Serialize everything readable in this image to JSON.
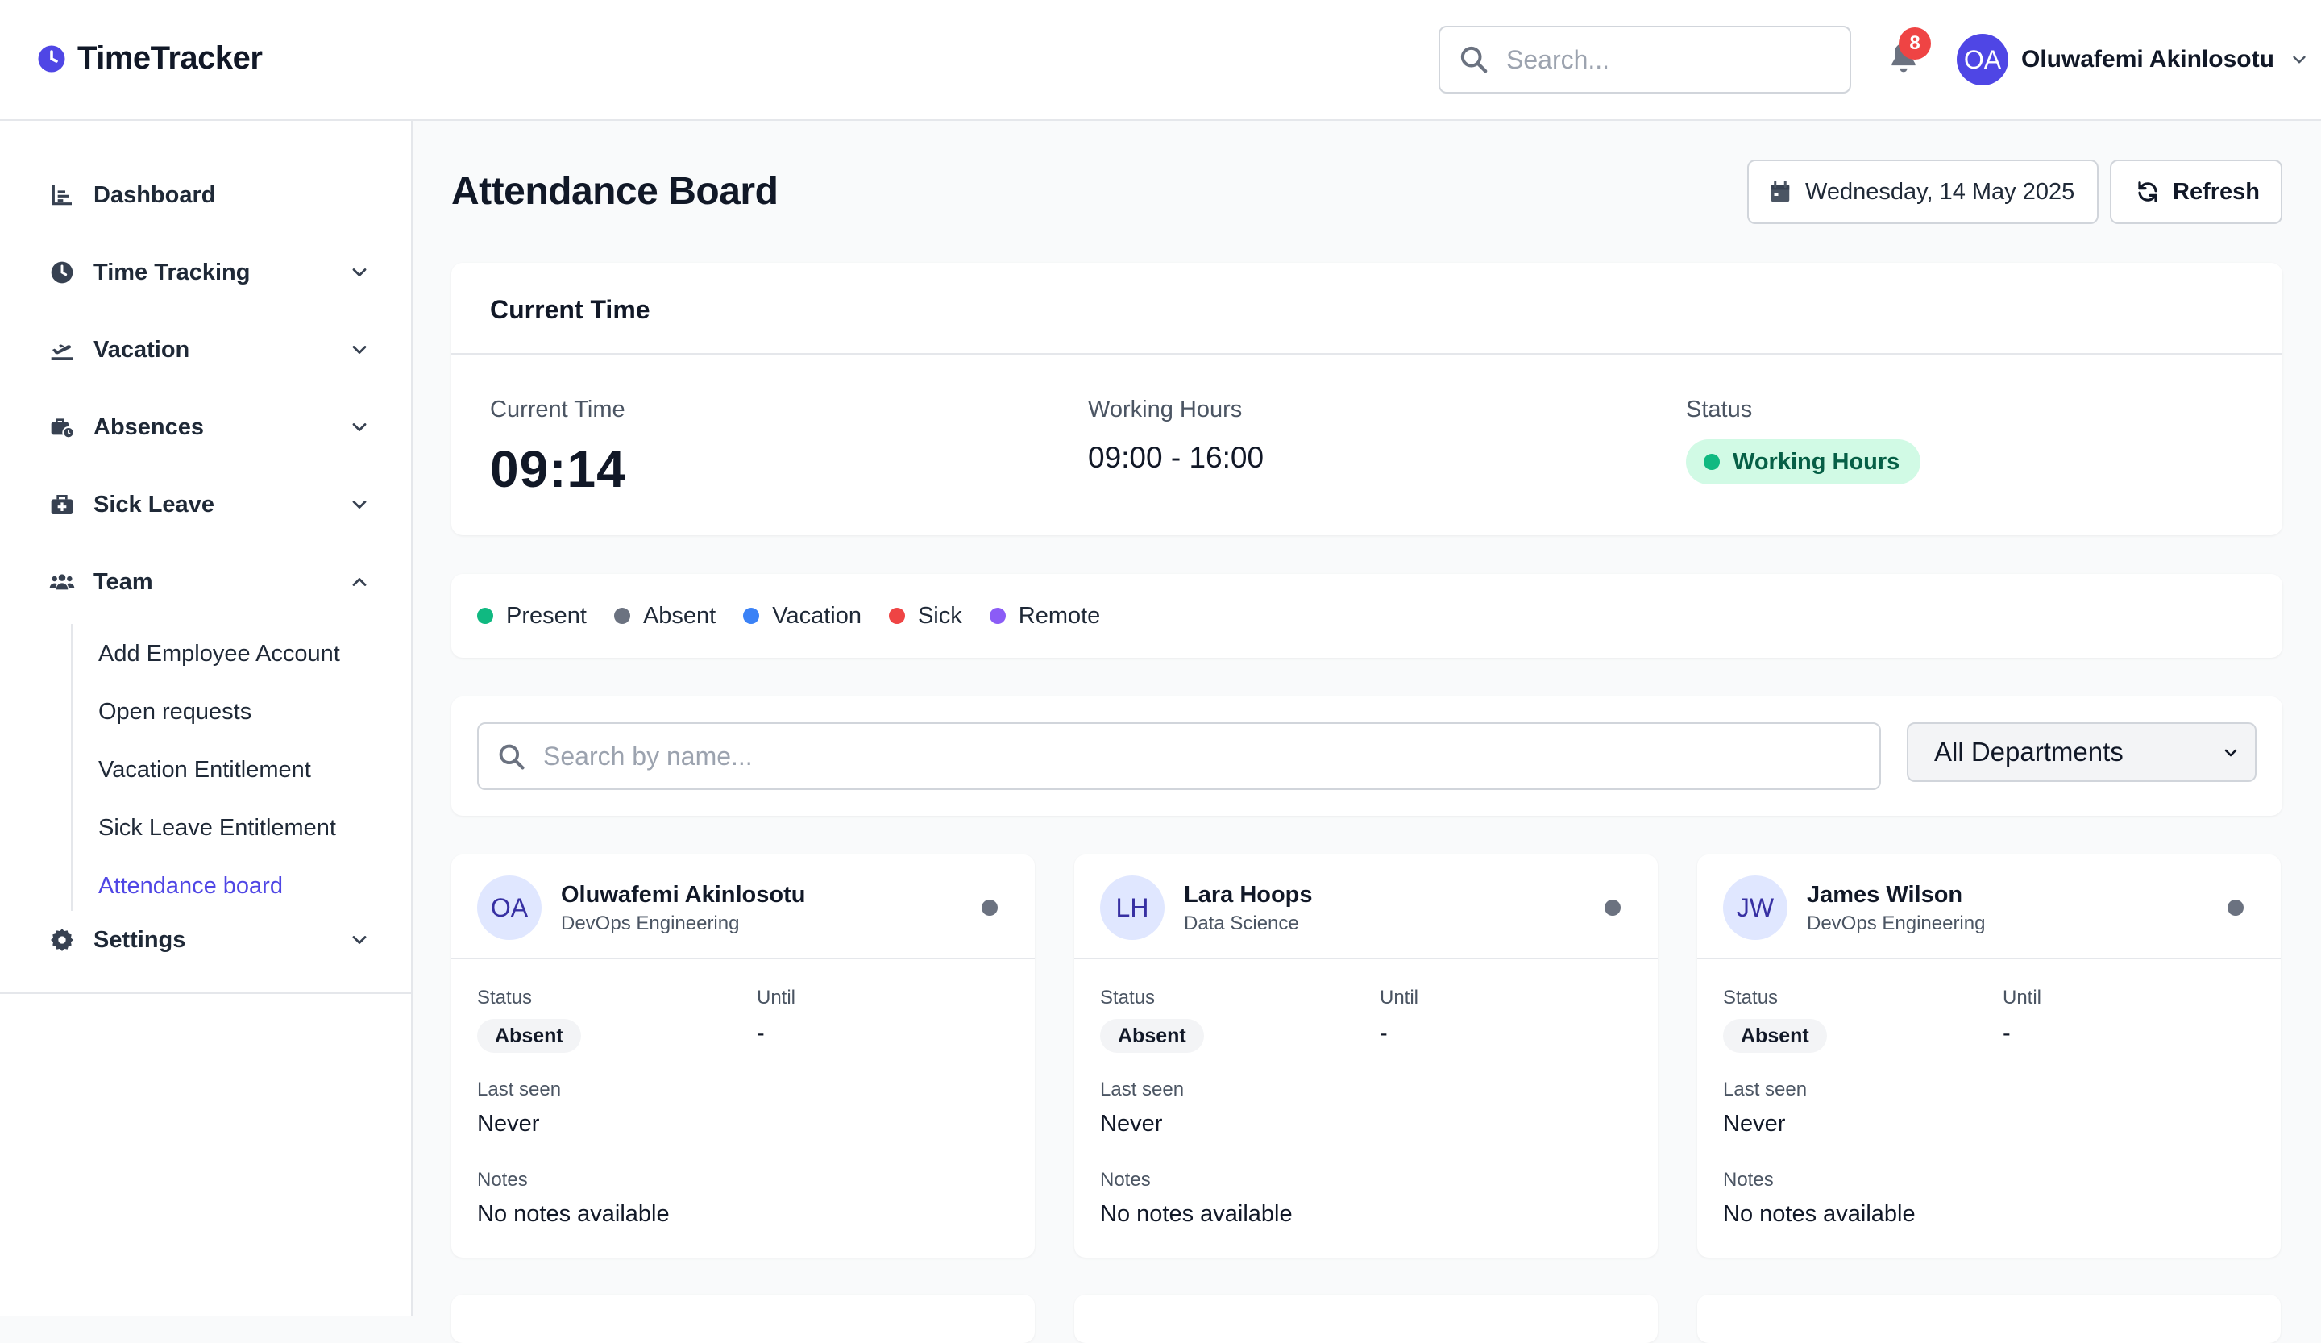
{
  "app": {
    "name": "TimeTracker",
    "brand_color": "#4f46e5"
  },
  "header": {
    "search_placeholder": "Search...",
    "notifications_count": "8",
    "user": {
      "initials": "OA",
      "name": "Oluwafemi Akinlosotu"
    }
  },
  "sidebar": {
    "items": [
      {
        "label": "Dashboard",
        "icon": "chart-icon"
      },
      {
        "label": "Time Tracking",
        "icon": "clock-icon"
      },
      {
        "label": "Vacation",
        "icon": "plane-icon"
      },
      {
        "label": "Absences",
        "icon": "briefcase-icon"
      },
      {
        "label": "Sick Leave",
        "icon": "medical-kit-icon"
      },
      {
        "label": "Team",
        "icon": "team-icon"
      },
      {
        "label": "Settings",
        "icon": "gear-icon"
      }
    ],
    "team_sub": [
      "Add Employee Account",
      "Open requests",
      "Vacation Entitlement",
      "Sick Leave Entitlement",
      "Attendance board"
    ]
  },
  "page": {
    "title": "Attendance Board",
    "date": "Wednesday, 14 May 2025",
    "refresh_label": "Refresh"
  },
  "current_time_card": {
    "heading": "Current Time",
    "time_label": "Current Time",
    "time_value": "09:14",
    "hours_label": "Working Hours",
    "hours_value": "09:00 - 16:00",
    "status_label": "Status",
    "status_value": "Working Hours"
  },
  "legend": [
    {
      "label": "Present",
      "color": "#10b981"
    },
    {
      "label": "Absent",
      "color": "#6b7280"
    },
    {
      "label": "Vacation",
      "color": "#3b82f6"
    },
    {
      "label": "Sick",
      "color": "#ef4444"
    },
    {
      "label": "Remote",
      "color": "#8b5cf6"
    }
  ],
  "filters": {
    "search_placeholder": "Search by name...",
    "department_selected": "All Departments"
  },
  "field_labels": {
    "status": "Status",
    "until": "Until",
    "last_seen": "Last seen",
    "notes": "Notes"
  },
  "employees": [
    {
      "initials": "OA",
      "name": "Oluwafemi Akinlosotu",
      "department": "DevOps Engineering",
      "status": "Absent",
      "until": "-",
      "last_seen": "Never",
      "notes": "No notes available"
    },
    {
      "initials": "LH",
      "name": "Lara Hoops",
      "department": "Data Science",
      "status": "Absent",
      "until": "-",
      "last_seen": "Never",
      "notes": "No notes available"
    },
    {
      "initials": "JW",
      "name": "James Wilson",
      "department": "DevOps Engineering",
      "status": "Absent",
      "until": "-",
      "last_seen": "Never",
      "notes": "No notes available"
    }
  ]
}
